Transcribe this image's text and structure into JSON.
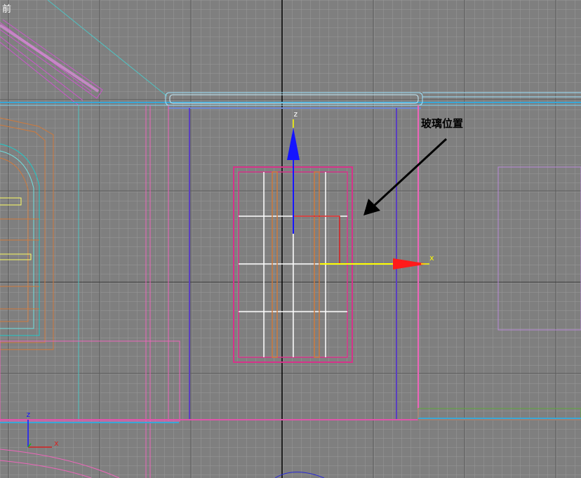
{
  "viewport": {
    "label": "前",
    "background": "#7f7f7f"
  },
  "annotation": {
    "text": "玻璃位置"
  },
  "gizmo": {
    "z_label": "z",
    "x_label": "x",
    "z_color": "#1414ff",
    "x_color": "#ff1a1a",
    "yellow": "#ffff00"
  },
  "axis_tripod": {
    "z_label": "z",
    "x_label": "x"
  }
}
